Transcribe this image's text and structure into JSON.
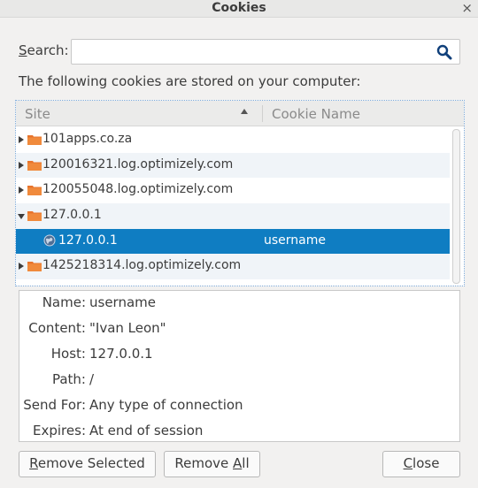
{
  "window": {
    "title": "Cookies",
    "close_glyph": "×"
  },
  "search": {
    "label_pre": "",
    "label_under": "S",
    "label_post": "earch:",
    "value": "",
    "placeholder": "",
    "icon": "search-icon"
  },
  "intro_text": "The following cookies are stored on your computer:",
  "table": {
    "headers": {
      "site": "Site",
      "cookie_name": "Cookie Name"
    },
    "rows": [
      {
        "site": "101apps.co.za",
        "expanded": false
      },
      {
        "site": "120016321.log.optimizely.com",
        "expanded": false
      },
      {
        "site": "120055048.log.optimizely.com",
        "expanded": false
      },
      {
        "site": "127.0.0.1",
        "expanded": true
      },
      {
        "child_site": "127.0.0.1",
        "cookie_name": "username",
        "selected": true
      },
      {
        "site": "1425218314.log.optimizely.com",
        "expanded": false
      }
    ]
  },
  "details": {
    "name": {
      "label": "Name:",
      "value": "username"
    },
    "content": {
      "label": "Content:",
      "value": "\"Ivan Leon\""
    },
    "host": {
      "label": "Host:",
      "value": "127.0.0.1"
    },
    "path": {
      "label": "Path:",
      "value": "/"
    },
    "send_for": {
      "label": "Send For:",
      "value": "Any type of connection"
    },
    "expires": {
      "label": "Expires:",
      "value": "At end of session"
    }
  },
  "buttons": {
    "remove_selected": {
      "under": "R",
      "rest": "emove Selected"
    },
    "remove_all": {
      "pre": "Remove ",
      "under": "A",
      "rest": "ll"
    },
    "close": {
      "under": "C",
      "rest": "lose"
    }
  },
  "colors": {
    "selection": "#0f7dc2",
    "folder": "#e8742c",
    "accent_border": "#7aa7d6"
  }
}
